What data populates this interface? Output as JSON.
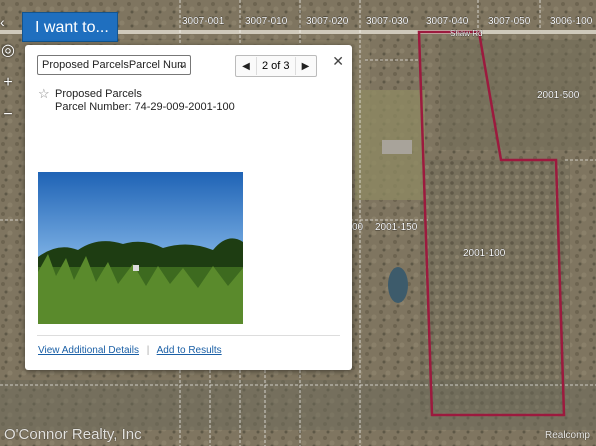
{
  "topbar": {
    "i_want_to_label": "I want to..."
  },
  "map": {
    "top_parcel_labels": [
      "3007-001",
      "3007-010",
      "3007-020",
      "3007-030",
      "3007-040",
      "3007-050",
      "3006-100"
    ],
    "road_label": "Shaw Rd",
    "parcel_labels": {
      "p1": "2001-500",
      "p2": "2001-150",
      "p3": "2001-100",
      "p4": "00"
    },
    "highlight_color": "#9c1a3e"
  },
  "popup": {
    "layer_select_value": "Proposed ParcelsParcel Num",
    "pager_text": "2 of 3",
    "layer_title": "Proposed Parcels",
    "parcel_number_text": "Parcel Number: 74-29-009-2001-100",
    "view_details_link": "View Additional Details",
    "add_results_link": "Add to Results"
  },
  "watermark": {
    "left": "O'Connor Realty, Inc",
    "right": "Realcomp"
  }
}
